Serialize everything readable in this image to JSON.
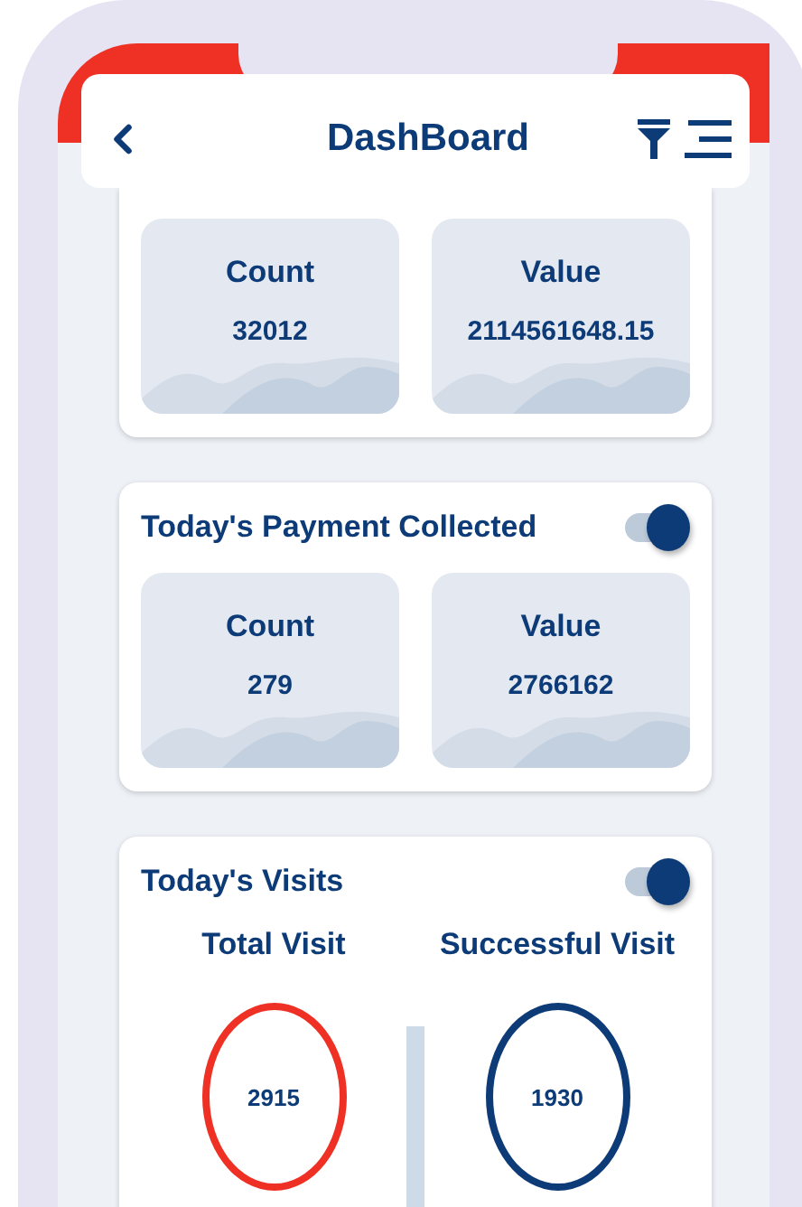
{
  "header": {
    "title": "DashBoard"
  },
  "sections": [
    {
      "kind": "tiles",
      "tiles": [
        {
          "label": "Count",
          "value": "32012"
        },
        {
          "label": "Value",
          "value": "2114561648.15"
        }
      ]
    },
    {
      "kind": "tiles",
      "title": "Today's Payment Collected",
      "on": true,
      "tiles": [
        {
          "label": "Count",
          "value": "279"
        },
        {
          "label": "Value",
          "value": "2766162"
        }
      ]
    },
    {
      "kind": "visits",
      "title": "Today's Visits",
      "on": true,
      "metrics": [
        {
          "label": "Total Visit",
          "value": "2915",
          "color": "#ee3124"
        },
        {
          "label": "Successful Visit",
          "value": "1930",
          "color": "#0d3b78"
        }
      ]
    }
  ]
}
